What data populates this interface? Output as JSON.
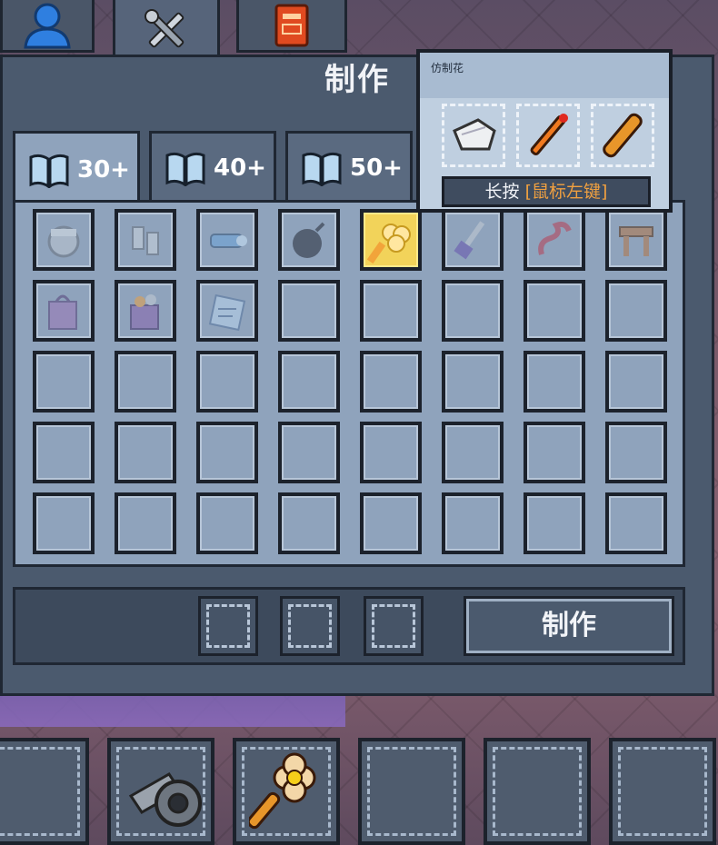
{
  "window": {
    "title": "制作"
  },
  "top_tabs": [
    {
      "id": "profile",
      "icon": "person-icon"
    },
    {
      "id": "crafting",
      "icon": "tools-icon"
    },
    {
      "id": "journal",
      "icon": "red-book-icon"
    }
  ],
  "book_tabs": [
    {
      "label": "30+",
      "active": true
    },
    {
      "label": "40+",
      "active": false
    },
    {
      "label": "50+",
      "active": false
    }
  ],
  "grid": {
    "items": [
      "bucket-icon",
      "wrench-parts-icon",
      "flashlight-icon",
      "bomb-icon",
      "fake-flower-icon",
      "paintbrush-icon",
      "hose-icon",
      "table-icon",
      "shopping-bag-icon",
      "grocery-bag-icon",
      "blueprint-box-icon"
    ],
    "selected_index": 4
  },
  "tooltip": {
    "name": "仿制花",
    "ingredients": [
      "paper-icon",
      "pen-icon",
      "wooden-stick-icon"
    ],
    "hint_prefix": "长按",
    "hint_key": "[鼠标左键]"
  },
  "craft": {
    "button_label": "制作"
  },
  "hotbar": [
    {
      "icon": ""
    },
    {
      "icon": "duct-tape-icon"
    },
    {
      "icon": "fake-flower-icon"
    },
    {
      "icon": ""
    },
    {
      "icon": ""
    },
    {
      "icon": ""
    }
  ],
  "colors": {
    "panel": "#4b5a6e",
    "slot": "#8fa3bc",
    "selected": "#f2d35a",
    "hint_key": "#f0a040"
  }
}
